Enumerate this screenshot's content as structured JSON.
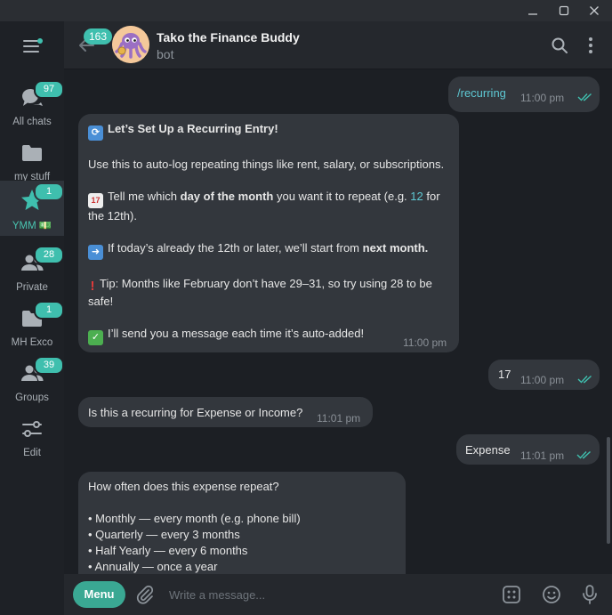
{
  "window": {
    "minimize_icon": "minimize-icon",
    "maximize_icon": "maximize-icon",
    "close_icon": "close-icon"
  },
  "sidebar": {
    "menu_icon": "hamburger-icon",
    "folders": [
      {
        "label": "All chats",
        "badge": "97",
        "icon": "chats-icon"
      },
      {
        "label": "my stuff",
        "badge": "",
        "icon": "folder-icon"
      },
      {
        "label": "YMM 💵",
        "badge": "1",
        "icon": "star-icon",
        "active": true
      },
      {
        "label": "Private",
        "badge": "28",
        "icon": "users-icon"
      },
      {
        "label": "MH Exco",
        "badge": "1",
        "icon": "folder-icon"
      },
      {
        "label": "Groups",
        "badge": "39",
        "icon": "users-icon"
      },
      {
        "label": "Edit",
        "badge": "",
        "icon": "edit-sliders-icon"
      }
    ]
  },
  "header": {
    "back_badge": "163",
    "title": "Tako the Finance Buddy",
    "subtitle": "bot",
    "search_icon": "search-icon",
    "more_icon": "more-vertical-icon"
  },
  "messages": {
    "m1": {
      "text": "/recurring",
      "time": "11:00 pm"
    },
    "m2": {
      "title": "Let’s Set Up a Recurring Entry!",
      "p1": "Use this to auto-log repeating things like rent, salary, or subscriptions.",
      "p2_a": "Tell me which ",
      "p2_b": "day of the month",
      "p2_c": " you want it to repeat (e.g. ",
      "p2_d": "12",
      "p2_e": " for the 12th).",
      "p3_a": "If today’s already the 12th or later, we’ll start from ",
      "p3_b": "next month.",
      "p4": "Tip: Months like February don’t have 29–31, so try using 28 to be safe!",
      "p5": "I’ll send you a message each time it’s auto-added!",
      "time": "11:00 pm"
    },
    "m3": {
      "text": "17",
      "time": "11:00 pm"
    },
    "m4": {
      "text": "Is this a recurring for Expense or Income?",
      "time": "11:01 pm"
    },
    "m5": {
      "text": "Expense",
      "time": "11:01 pm"
    },
    "m6": {
      "title": "How often does this expense repeat?",
      "items": [
        "• Monthly — every month (e.g. phone bill)",
        "• Quarterly — every 3 months",
        "• Half Yearly — every 6 months",
        "• Annually — once a year"
      ]
    }
  },
  "input": {
    "menu_label": "Menu",
    "placeholder": "Write a message...",
    "attach_icon": "paperclip-icon",
    "commands_icon": "bot-commands-icon",
    "emoji_icon": "emoji-icon",
    "mic_icon": "microphone-icon"
  },
  "colors": {
    "accent": "#3fbfae",
    "bubble": "#33373d",
    "background": "#1c1f24",
    "link": "#5ec9d4"
  }
}
